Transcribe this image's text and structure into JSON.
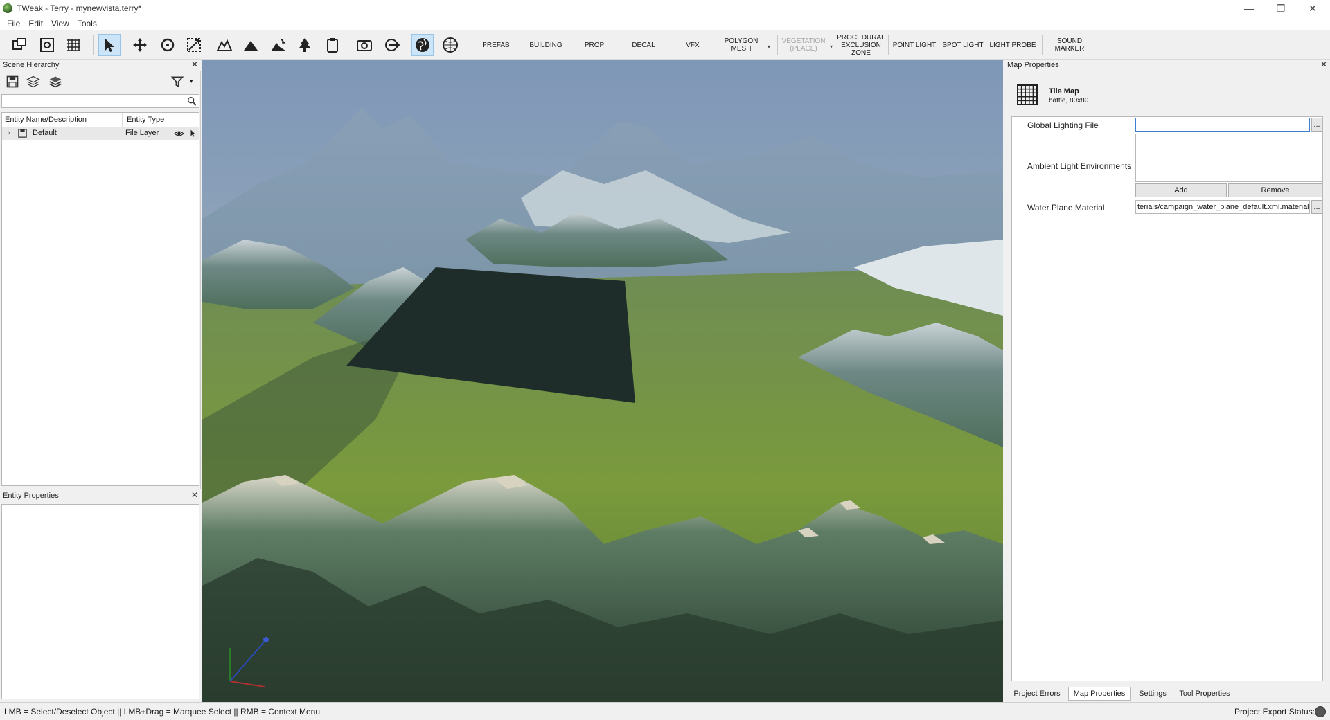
{
  "window": {
    "title": "TWeak - Terry - mynewvista.terry*",
    "minimize_glyph": "—",
    "restore_glyph": "❐",
    "close_glyph": "✕"
  },
  "menu": [
    "File",
    "Edit",
    "View",
    "Tools"
  ],
  "toolbar": {
    "text_buttons": {
      "prefab": "PREFAB",
      "building": "BUILDING",
      "prop": "PROP",
      "decal": "DECAL",
      "vfx": "VFX",
      "polygon_mesh": "POLYGON MESH",
      "vegetation": "VEGETATION (PLACE)",
      "procedural_exclusion_zone": "PROCEDURAL EXCLUSION ZONE",
      "point_light": "POINT LIGHT",
      "spot_light": "SPOT LIGHT",
      "light_probe": "LIGHT PROBE",
      "sound_marker": "SOUND MARKER"
    },
    "dropdown_glyph": "▾"
  },
  "scene_hierarchy": {
    "title": "Scene Hierarchy",
    "close_glyph": "✕",
    "search_placeholder": "",
    "columns": [
      "Entity Name/Description",
      "Entity Type"
    ],
    "rows": [
      {
        "expander": "›",
        "name": "Default",
        "type": "File Layer"
      }
    ]
  },
  "entity_properties": {
    "title": "Entity Properties",
    "close_glyph": "✕"
  },
  "map_properties": {
    "title": "Map Properties",
    "close_glyph": "✕",
    "tile_map": {
      "title": "Tile Map",
      "subtitle": "battle, 80x80"
    },
    "global_lighting_label": "Global Lighting File",
    "global_lighting_value": "",
    "browse_glyph": "...",
    "ambient_label": "Ambient Light Environments",
    "add_label": "Add",
    "remove_label": "Remove",
    "water_label": "Water Plane Material",
    "water_value": "terials/campaign_water_plane_default.xml.material"
  },
  "bottom_tabs": [
    "Project Errors",
    "Map Properties",
    "Settings",
    "Tool Properties"
  ],
  "statusbar": {
    "hint": "LMB = Select/Deselect Object || LMB+Drag = Marquee Select || RMB = Context Menu",
    "export_status": "Project Export Status:"
  }
}
